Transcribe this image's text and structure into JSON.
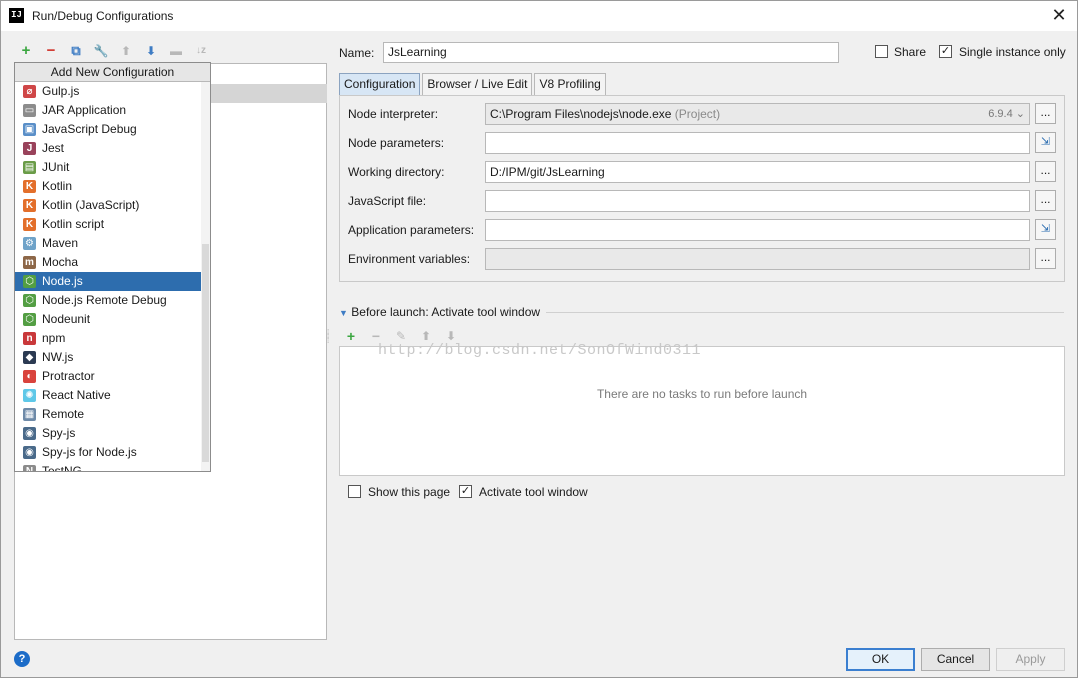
{
  "window": {
    "title": "Run/Debug Configurations",
    "app_icon_text": "IJ"
  },
  "popup": {
    "header": "Add New Configuration",
    "items": [
      {
        "label": "Gulp.js",
        "icon": "gulp-icon",
        "color": "#cf4647",
        "glyph": "⌀"
      },
      {
        "label": "JAR Application",
        "icon": "jar-icon",
        "color": "#8c8c8c",
        "glyph": "▭"
      },
      {
        "label": "JavaScript Debug",
        "icon": "js-debug-icon",
        "color": "#5a8fc8",
        "glyph": "▣"
      },
      {
        "label": "Jest",
        "icon": "jest-icon",
        "color": "#99425b",
        "glyph": "J"
      },
      {
        "label": "JUnit",
        "icon": "junit-icon",
        "color": "#6a9c48",
        "glyph": "▤"
      },
      {
        "label": "Kotlin",
        "icon": "kotlin-icon",
        "color": "#e36f2b",
        "glyph": "K"
      },
      {
        "label": "Kotlin (JavaScript)",
        "icon": "kotlin-js-icon",
        "color": "#e36f2b",
        "glyph": "K"
      },
      {
        "label": "Kotlin script",
        "icon": "kotlin-script-icon",
        "color": "#e36f2b",
        "glyph": "K"
      },
      {
        "label": "Maven",
        "icon": "maven-icon",
        "color": "#6fa3c9",
        "glyph": "⚙"
      },
      {
        "label": "Mocha",
        "icon": "mocha-icon",
        "color": "#8d6748",
        "glyph": "m"
      },
      {
        "label": "Node.js",
        "icon": "nodejs-icon",
        "color": "#539e43",
        "glyph": "⬡"
      },
      {
        "label": "Node.js Remote Debug",
        "icon": "nodejs-remote-icon",
        "color": "#539e43",
        "glyph": "⬡"
      },
      {
        "label": "Nodeunit",
        "icon": "nodeunit-icon",
        "color": "#539e43",
        "glyph": "⬡"
      },
      {
        "label": "npm",
        "icon": "npm-icon",
        "color": "#c9383a",
        "glyph": "n"
      },
      {
        "label": "NW.js",
        "icon": "nwjs-icon",
        "color": "#2b3a52",
        "glyph": "◆"
      },
      {
        "label": "Protractor",
        "icon": "protractor-icon",
        "color": "#d9433c",
        "glyph": "◐"
      },
      {
        "label": "React Native",
        "icon": "react-native-icon",
        "color": "#5ec8e8",
        "glyph": "✺"
      },
      {
        "label": "Remote",
        "icon": "remote-icon",
        "color": "#6e8aa8",
        "glyph": "▦"
      },
      {
        "label": "Spy-js",
        "icon": "spy-js-icon",
        "color": "#4a6a8a",
        "glyph": "◉"
      },
      {
        "label": "Spy-js for Node.js",
        "icon": "spy-js-node-icon",
        "color": "#4a6a8a",
        "glyph": "◉"
      },
      {
        "label": "TestNG",
        "icon": "testng-icon",
        "color": "#8b8b8b",
        "glyph": "N"
      }
    ],
    "selected": "Node.js"
  },
  "left_toolbar": {
    "add": "+",
    "remove": "−",
    "copy": "⧉",
    "edit_defaults": "🔧",
    "move_up": "⬆",
    "move_down": "⬇",
    "folder": "▬",
    "sort": "↓z"
  },
  "name": {
    "label": "Name:",
    "value": "JsLearning"
  },
  "share": {
    "label": "Share",
    "checked": false
  },
  "single_instance": {
    "label": "Single instance only",
    "checked": true
  },
  "tabs": [
    "Configuration",
    "Browser / Live Edit",
    "V8 Profiling"
  ],
  "fields": {
    "node_interpreter": {
      "label": "Node interpreter:",
      "value": "C:\\Program Files\\nodejs\\node.exe",
      "note": "(Project)",
      "version": "6.9.4"
    },
    "node_parameters": {
      "label": "Node parameters:",
      "value": ""
    },
    "working_directory": {
      "label": "Working directory:",
      "value": "D:/IPM/git/JsLearning"
    },
    "javascript_file": {
      "label": "JavaScript file:",
      "value": ""
    },
    "application_parameters": {
      "label": "Application parameters:",
      "value": ""
    },
    "environment_variables": {
      "label": "Environment variables:",
      "value": ""
    }
  },
  "ellipsis": "...",
  "before_launch": {
    "title": "Before launch: Activate tool window",
    "empty": "There are no tasks to run before launch",
    "watermark": "http://blog.csdn.net/SonOfWind0311"
  },
  "show_this_page": {
    "label": "Show this page",
    "checked": false
  },
  "activate_tool_window": {
    "label": "Activate tool window",
    "checked": true
  },
  "buttons": {
    "ok": "OK",
    "cancel": "Cancel",
    "apply": "Apply",
    "help": "?"
  },
  "check_mark": "✓"
}
